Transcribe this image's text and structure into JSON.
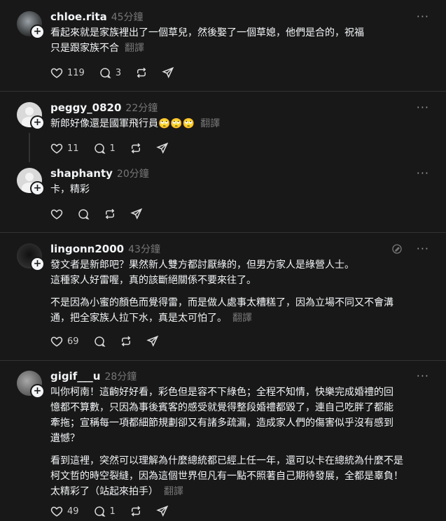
{
  "posts": [
    {
      "username": "chloe.rita",
      "time": "45分鐘",
      "lines": [
        "看起來就是家族裡出了一個草兒，然後娶了一個草媳，他們是合的，祝福",
        "只是跟家族不合"
      ],
      "translate": "翻譯",
      "likes": "119",
      "replies": "3"
    },
    {
      "username": "peggy_0820",
      "time": "22分鐘",
      "text": "新郎好像還是國軍飛行員🙄🙄🙄",
      "translate": "翻譯",
      "likes": "11",
      "replies": "1"
    },
    {
      "username": "shaphanty",
      "time": "20分鐘",
      "text": "卡，精彩"
    },
    {
      "username": "lingonn2000",
      "time": "43分鐘",
      "lines": [
        "發文者是新郎吧？果然新人雙方都討厭綠的，但男方家人是綠營人士。",
        "這種家人好雷喔，真的該斷絕關係不要來往了。"
      ],
      "lines2": [
        "不是因為小蜜的顏色而覺得雷，而是做人處事太糟糕了，因為立場不同又不會溝",
        "通，把全家族人拉下水，真是太可怕了。"
      ],
      "translate": "翻譯",
      "likes": "69"
    },
    {
      "username": "gigif___u",
      "time": "28分鐘",
      "lines": [
        "叫你柯南！這齣好好看，彩色但是容不下綠色；全程不知情，快樂完成婚禮的回",
        "憶都不算數，只因為事後賓客的感受就覺得整段婚禮都毀了，連自己吃胖了都能",
        "牽拖；宣稱每一項都細節規劃卻又有諸多疏漏，造成家人們的傷害似乎沒有感到",
        "遺憾？"
      ],
      "lines2": [
        "看到這裡，突然可以理解為什麼總統都已經上任一年，還可以卡在總統為什麼不是",
        "柯文哲的時空裂縫，因為這個世界但凡有一點不照著自己期待發展，全都是辜負！",
        "太精彩了（站起來拍手）"
      ],
      "translate": "翻譯",
      "likes": "49",
      "replies": "1"
    }
  ],
  "ui": {
    "more": "···",
    "plus": "+"
  }
}
